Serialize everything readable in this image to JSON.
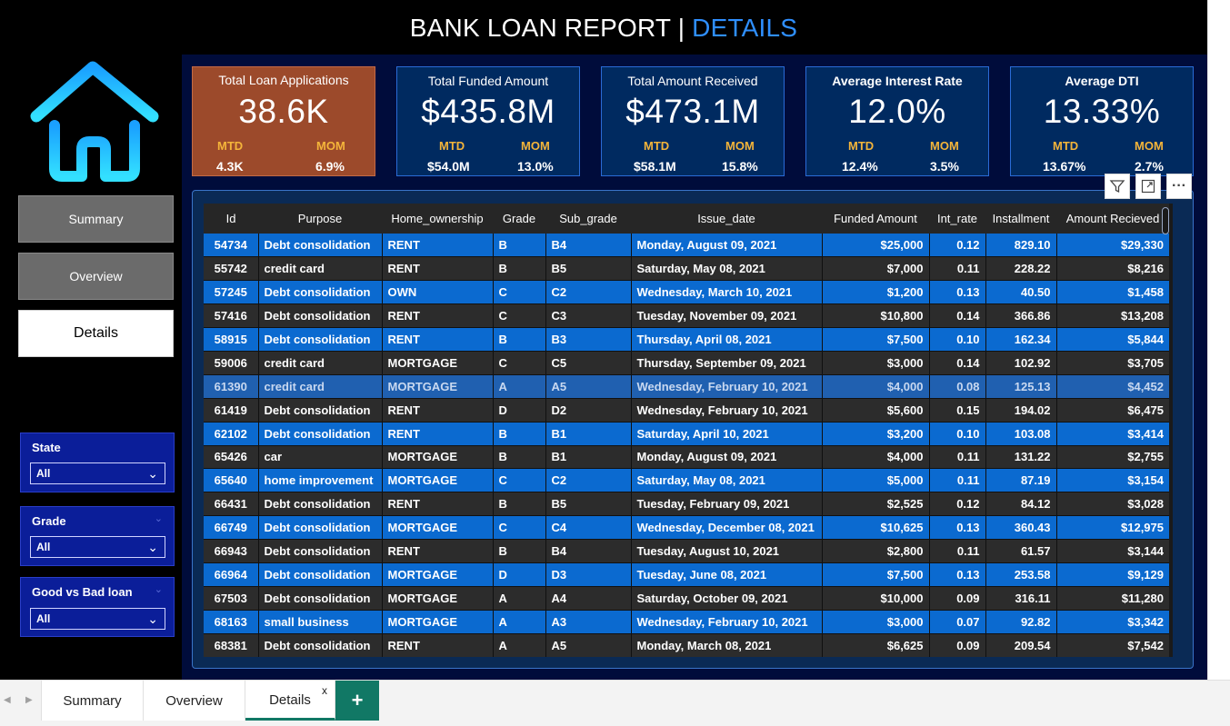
{
  "header": {
    "title_main": "BANK LOAN REPORT | ",
    "title_accent": "DETAILS"
  },
  "nav": {
    "summary": "Summary",
    "overview": "Overview",
    "details": "Details"
  },
  "slicers": [
    {
      "label": "State",
      "value": "All"
    },
    {
      "label": "Grade",
      "value": "All"
    },
    {
      "label": "Good vs Bad loan",
      "value": "All"
    }
  ],
  "kpis": [
    {
      "title": "Total Loan Applications",
      "value": "38.6K",
      "mtd_label": "MTD",
      "mom_label": "MOM",
      "mtd": "4.3K",
      "mom": "6.9%"
    },
    {
      "title": "Total Funded Amount",
      "value": "$435.8M",
      "mtd_label": "MTD",
      "mom_label": "MOM",
      "mtd": "$54.0M",
      "mom": "13.0%"
    },
    {
      "title": "Total Amount Received",
      "value": "$473.1M",
      "mtd_label": "MTD",
      "mom_label": "MOM",
      "mtd": "$58.1M",
      "mom": "15.8%"
    },
    {
      "title": "Average Interest Rate",
      "value": "12.0%",
      "mtd_label": "MTD",
      "mom_label": "MOM",
      "mtd": "12.4%",
      "mom": "3.5%"
    },
    {
      "title": "Average DTI",
      "value": "13.33%",
      "mtd_label": "MTD",
      "mom_label": "MOM",
      "mtd": "13.67%",
      "mom": "2.7%"
    }
  ],
  "visual_header": {
    "filter_icon": "filter-icon",
    "focus_icon": "focus-mode-icon",
    "more_icon": "more-options-icon",
    "more_glyph": "···"
  },
  "table": {
    "columns": [
      "Id",
      "Purpose",
      "Home_ownership",
      "Grade",
      "Sub_grade",
      "Issue_date",
      "Funded Amount",
      "Int_rate",
      "Installment",
      "Amount Recieved"
    ],
    "rows": [
      [
        "54734",
        "Debt consolidation",
        "RENT",
        "B",
        "B4",
        "Monday, August 09, 2021",
        "$25,000",
        "0.12",
        "829.10",
        "$29,330"
      ],
      [
        "55742",
        "credit card",
        "RENT",
        "B",
        "B5",
        "Saturday, May 08, 2021",
        "$7,000",
        "0.11",
        "228.22",
        "$8,216"
      ],
      [
        "57245",
        "Debt consolidation",
        "OWN",
        "C",
        "C2",
        "Wednesday, March 10, 2021",
        "$1,200",
        "0.13",
        "40.50",
        "$1,458"
      ],
      [
        "57416",
        "Debt consolidation",
        "RENT",
        "C",
        "C3",
        "Tuesday, November 09, 2021",
        "$10,800",
        "0.14",
        "366.86",
        "$13,208"
      ],
      [
        "58915",
        "Debt consolidation",
        "RENT",
        "B",
        "B3",
        "Thursday, April 08, 2021",
        "$7,500",
        "0.10",
        "162.34",
        "$5,844"
      ],
      [
        "59006",
        "credit card",
        "MORTGAGE",
        "C",
        "C5",
        "Thursday, September 09, 2021",
        "$3,000",
        "0.14",
        "102.92",
        "$3,705"
      ],
      [
        "61390",
        "credit card",
        "MORTGAGE",
        "A",
        "A5",
        "Wednesday, February 10, 2021",
        "$4,000",
        "0.08",
        "125.13",
        "$4,452"
      ],
      [
        "61419",
        "Debt consolidation",
        "RENT",
        "D",
        "D2",
        "Wednesday, February 10, 2021",
        "$5,600",
        "0.15",
        "194.02",
        "$6,475"
      ],
      [
        "62102",
        "Debt consolidation",
        "RENT",
        "B",
        "B1",
        "Saturday, April 10, 2021",
        "$3,200",
        "0.10",
        "103.08",
        "$3,414"
      ],
      [
        "65426",
        "car",
        "MORTGAGE",
        "B",
        "B1",
        "Monday, August 09, 2021",
        "$4,000",
        "0.11",
        "131.22",
        "$2,755"
      ],
      [
        "65640",
        "home improvement",
        "MORTGAGE",
        "C",
        "C2",
        "Saturday, May 08, 2021",
        "$5,000",
        "0.11",
        "87.19",
        "$3,154"
      ],
      [
        "66431",
        "Debt consolidation",
        "RENT",
        "B",
        "B5",
        "Tuesday, February 09, 2021",
        "$2,525",
        "0.12",
        "84.12",
        "$3,028"
      ],
      [
        "66749",
        "Debt consolidation",
        "MORTGAGE",
        "C",
        "C4",
        "Wednesday, December 08, 2021",
        "$10,625",
        "0.13",
        "360.43",
        "$12,975"
      ],
      [
        "66943",
        "Debt consolidation",
        "RENT",
        "B",
        "B4",
        "Tuesday, August 10, 2021",
        "$2,800",
        "0.11",
        "61.57",
        "$3,144"
      ],
      [
        "66964",
        "Debt consolidation",
        "MORTGAGE",
        "D",
        "D3",
        "Tuesday, June 08, 2021",
        "$7,500",
        "0.13",
        "253.58",
        "$9,129"
      ],
      [
        "67503",
        "Debt consolidation",
        "MORTGAGE",
        "A",
        "A4",
        "Saturday, October 09, 2021",
        "$10,000",
        "0.09",
        "316.11",
        "$11,280"
      ],
      [
        "68163",
        "small business",
        "MORTGAGE",
        "A",
        "A3",
        "Wednesday, February 10, 2021",
        "$3,000",
        "0.07",
        "92.82",
        "$3,342"
      ],
      [
        "68381",
        "Debt consolidation",
        "RENT",
        "A",
        "A5",
        "Monday, March 08, 2021",
        "$6,625",
        "0.09",
        "209.54",
        "$7,542"
      ]
    ]
  },
  "page_tabs": {
    "summary": "Summary",
    "overview": "Overview",
    "details": "Details",
    "close": "x",
    "add": "+"
  },
  "colors": {
    "accent": "#2f8fff",
    "kpi_highlight": "#9c4a2b",
    "kpi_bg": "#002a60",
    "row_blue": "#0b6ad0",
    "tab_green": "#117865"
  }
}
